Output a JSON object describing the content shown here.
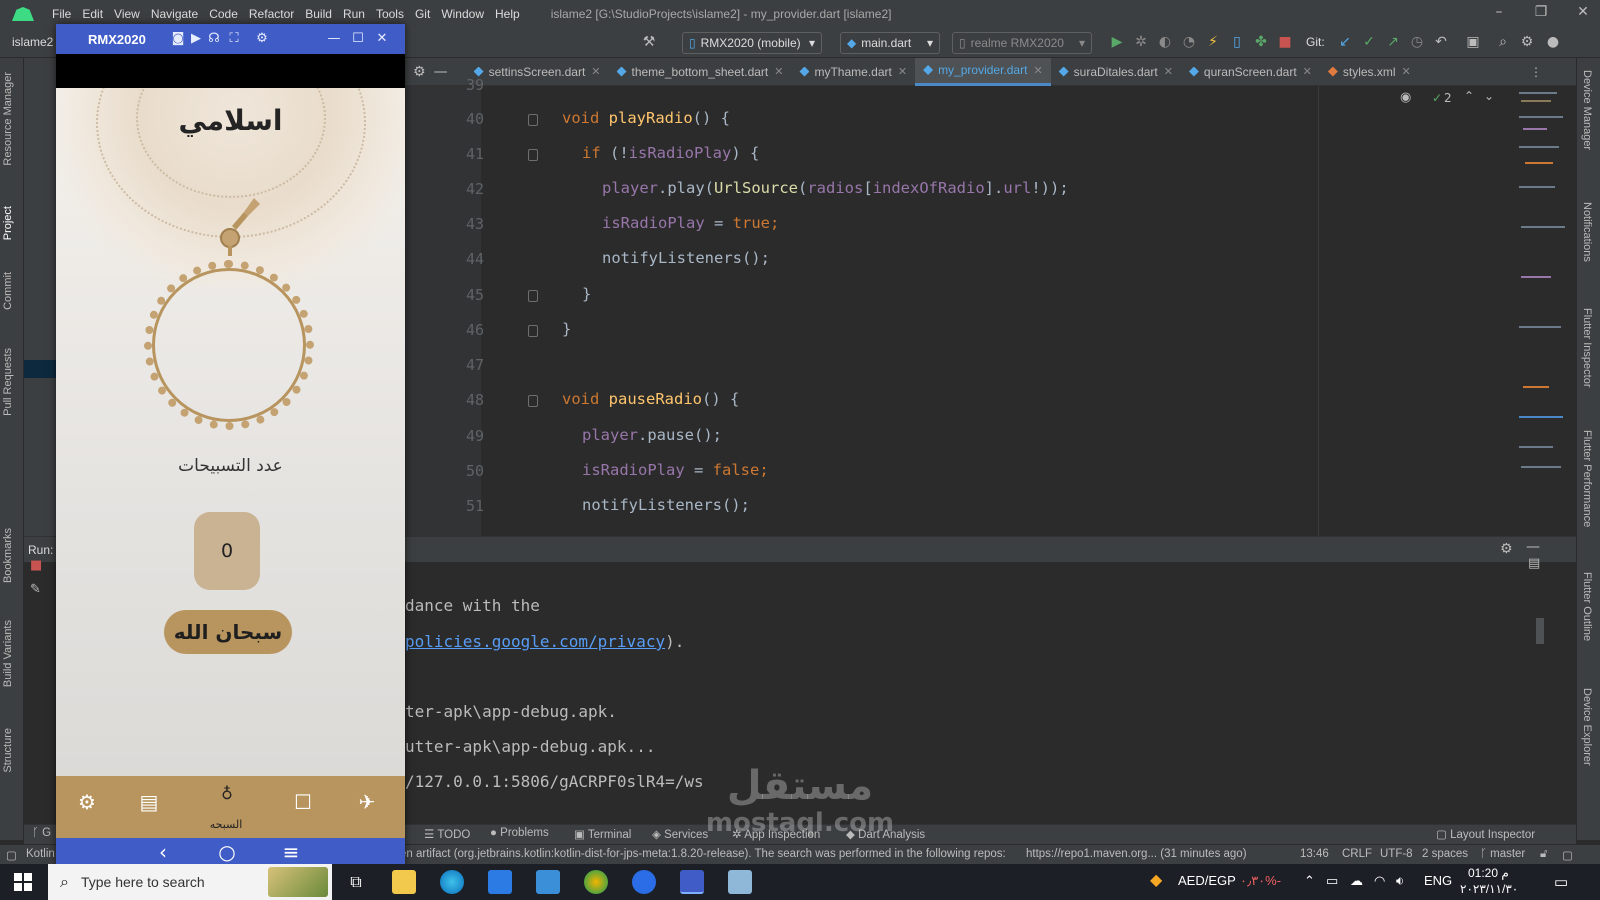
{
  "menubar": {
    "items": [
      "File",
      "Edit",
      "View",
      "Navigate",
      "Code",
      "Refactor",
      "Build",
      "Run",
      "Tools",
      "Git",
      "Window",
      "Help"
    ],
    "window_title": "islame2 [G:\\StudioProjects\\islame2] - my_provider.dart [islame2]"
  },
  "toolbar": {
    "project_name": "islame2",
    "device_combo": "RMX2020 (mobile)",
    "run_config": "main.dart",
    "device_target": "realme RMX2020",
    "git_label": "Git:"
  },
  "tabs": [
    {
      "label": "settinsScreen.dart",
      "active": false
    },
    {
      "label": "theme_bottom_sheet.dart",
      "active": false
    },
    {
      "label": "myThame.dart",
      "active": false
    },
    {
      "label": "my_provider.dart",
      "active": true
    },
    {
      "label": "suraDitales.dart",
      "active": false
    },
    {
      "label": "quranScreen.dart",
      "active": false
    },
    {
      "label": "styles.xml",
      "active": false
    }
  ],
  "editor": {
    "inspection_count": "2",
    "line_numbers": [
      "39",
      "40",
      "41",
      "42",
      "43",
      "44",
      "45",
      "46",
      "47",
      "48",
      "49",
      "50",
      "51"
    ],
    "lines": {
      "l40": {
        "kw": "void",
        "fn": "playRadio",
        "rest": "() {"
      },
      "l41": {
        "kw": "if",
        "rest1": " (!",
        "fld": "isRadioPlay",
        "rest2": ") {"
      },
      "l42": {
        "fld": "player",
        "rest1": ".play(",
        "cls": "UrlSource",
        "rest2": "(",
        "fld2": "radios",
        "rest3": "[",
        "fld3": "indexOfRadio",
        "rest4": "].",
        "fld4": "url",
        "rest5": "!));"
      },
      "l43": {
        "fld": "isRadioPlay",
        "rest": " = ",
        "kw": "true",
        "end": ";"
      },
      "l44": {
        "text": "notifyListeners();"
      },
      "l45": {
        "text": "}"
      },
      "l46": {
        "text": "}"
      },
      "l48": {
        "kw": "void",
        "fn": "pauseRadio",
        "rest": "() {"
      },
      "l49": {
        "fld": "player",
        "rest": ".pause();"
      },
      "l50": {
        "fld": "isRadioPlay",
        "rest": " = ",
        "kw": "false",
        "end": ";"
      },
      "l51": {
        "text": "notifyListeners();"
      }
    }
  },
  "run_panel": {
    "label": "Run:",
    "output": {
      "line1": "dance with the",
      "line2_link": "policies.google.com/privacy",
      "line2_rest": ").",
      "line3": "ter-apk\\app-debug.apk.",
      "line4": "utter-apk\\app-debug.apk...",
      "line5": "/127.0.0.1:5806/gACRPF0slR4=/ws"
    }
  },
  "bottom_tools": [
    "TODO",
    "Problems",
    "Terminal",
    "Services",
    "App Inspection",
    "Dart Analysis",
    "Layout Inspector"
  ],
  "bottom_tool_partial": "G",
  "status": {
    "kotlin": "Kotlin",
    "message": "en artifact (org.jetbrains.kotlin:kotlin-dist-for-jps-meta:1.8.20-release). The search was performed in the following repos:",
    "repo": "https://repo1.maven.org... (31 minutes ago)",
    "position": "13:46",
    "line_sep": "CRLF",
    "encoding": "UTF-8",
    "indent": "2 spaces",
    "branch": "master"
  },
  "left_strip": [
    "Resource Manager",
    "Project",
    "Commit",
    "Pull Requests",
    "Bookmarks",
    "Build Variants",
    "Structure"
  ],
  "right_strip": [
    "Device Manager",
    "Notifications",
    "Flutter Inspector",
    "Flutter Performance",
    "Flutter Outline",
    "Device Explorer"
  ],
  "emulator": {
    "name": "RMX2020",
    "app_title": "اسلامي",
    "count_label": "عدد التسبيحات",
    "count_value": "0",
    "tasbeeh_button": "سبحان الله",
    "nav_active_label": "السبحه"
  },
  "taskbar": {
    "search_placeholder": "Type here to search",
    "currency": "AED/EGP",
    "currency_change": "٠٫٣٠%-",
    "lang": "ENG",
    "time": "01:20 م",
    "date": "٢٠٢٣/١١/٣٠"
  },
  "watermark": {
    "text": "مستقل",
    "sub": "mostaql.com"
  },
  "colors": {
    "accent": "#4a88c7",
    "emulator_chrome": "#3f5cc7",
    "app_gold": "#b8955f",
    "bg": "#2b2b2b"
  }
}
